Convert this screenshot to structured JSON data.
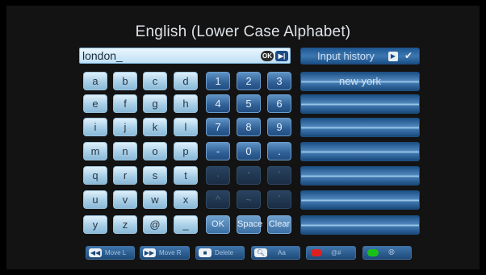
{
  "title": "English (Lower Case Alphabet)",
  "input": {
    "value": "london_",
    "ok_badge": "OK",
    "play_badge": "▶|"
  },
  "keys": {
    "row1": [
      "a",
      "b",
      "c",
      "d",
      "1",
      "2",
      "3"
    ],
    "row2": [
      "e",
      "f",
      "g",
      "h",
      "4",
      "5",
      "6"
    ],
    "row3": [
      "i",
      "j",
      "k",
      "l",
      "7",
      "8",
      "9"
    ],
    "row4": [
      "m",
      "n",
      "o",
      "p",
      "-",
      "0",
      "."
    ],
    "row5": [
      "q",
      "r",
      "s",
      "t",
      "·",
      "'",
      "`"
    ],
    "row6": [
      "u",
      "v",
      "w",
      "x",
      "^",
      "~",
      "´"
    ],
    "row7": [
      "y",
      "z",
      "@",
      "_",
      "OK",
      "Space",
      "Clear"
    ]
  },
  "history": {
    "header": "Input history",
    "items": [
      "new york",
      "",
      "",
      "",
      "",
      "",
      ""
    ]
  },
  "footer": {
    "move_left": "Move L",
    "move_right": "Move R",
    "delete": "Delete",
    "case": "Aa",
    "symbols": "@#",
    "language_icon": "globe-icon"
  },
  "colors": {
    "red_key": "#e02020",
    "green_key": "#18c018",
    "accent": "#2e5f96"
  }
}
